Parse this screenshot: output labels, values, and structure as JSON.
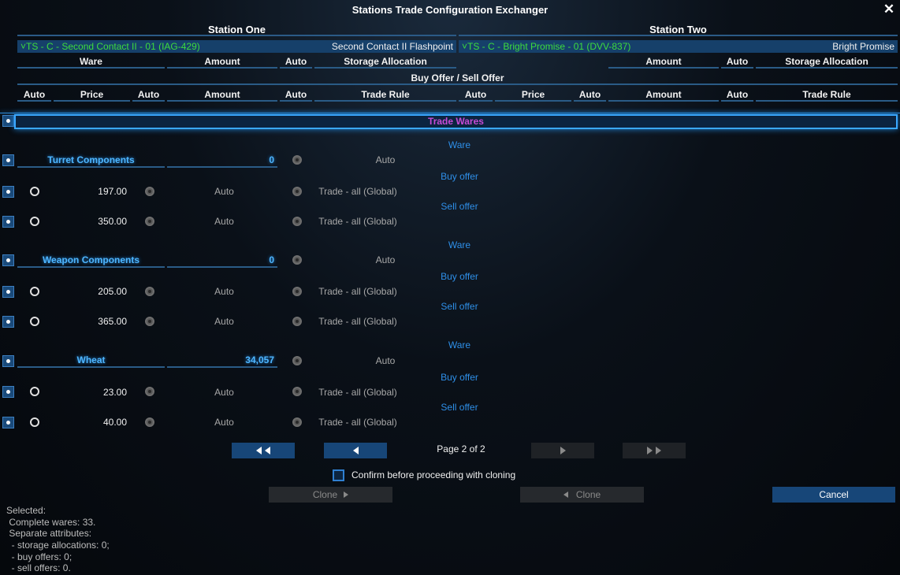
{
  "window": {
    "title": "Stations Trade Configuration Exchanger",
    "close_label": "✕"
  },
  "station_one": {
    "title": "Station One",
    "dropdown_left": "˅TS - C - Second Contact II - 01 (IAG-429)",
    "dropdown_right": "Second Contact II Flashpoint",
    "headers": {
      "ware": "Ware",
      "amount": "Amount",
      "auto": "Auto",
      "storage": "Storage Allocation"
    },
    "offer_headers": {
      "auto1": "Auto",
      "price": "Price",
      "auto2": "Auto",
      "amount": "Amount",
      "auto3": "Auto",
      "trade_rule": "Trade Rule"
    }
  },
  "station_two": {
    "title": "Station Two",
    "dropdown_left": "˅TS - C - Bright Promise - 01 (DVV-837)",
    "dropdown_right": "Bright Promise",
    "headers": {
      "amount": "Amount",
      "auto": "Auto",
      "storage": "Storage Allocation"
    },
    "offer_headers": {
      "auto1": "Auto",
      "price": "Price",
      "auto2": "Auto",
      "amount": "Amount",
      "auto3": "Auto",
      "trade_rule": "Trade Rule"
    }
  },
  "buy_sell_header": "Buy Offer / Sell Offer",
  "trade_wares_label": "Trade Wares",
  "wares": [
    {
      "name": "Turret Components",
      "amount": "0",
      "storage_auto": "Auto",
      "ware_label": "Ware",
      "buy_label": "Buy offer",
      "sell_label": "Sell offer",
      "buy": {
        "price": "197.00",
        "amount": "Auto",
        "rule": "Trade - all (Global)"
      },
      "sell": {
        "price": "350.00",
        "amount": "Auto",
        "rule": "Trade - all (Global)"
      }
    },
    {
      "name": "Weapon Components",
      "amount": "0",
      "storage_auto": "Auto",
      "ware_label": "Ware",
      "buy_label": "Buy offer",
      "sell_label": "Sell offer",
      "buy": {
        "price": "205.00",
        "amount": "Auto",
        "rule": "Trade - all (Global)"
      },
      "sell": {
        "price": "365.00",
        "amount": "Auto",
        "rule": "Trade - all (Global)"
      }
    },
    {
      "name": "Wheat",
      "amount": "34,057",
      "storage_auto": "Auto",
      "ware_label": "Ware",
      "buy_label": "Buy offer",
      "sell_label": "Sell offer",
      "buy": {
        "price": "23.00",
        "amount": "Auto",
        "rule": "Trade - all (Global)"
      },
      "sell": {
        "price": "40.00",
        "amount": "Auto",
        "rule": "Trade - all (Global)"
      }
    }
  ],
  "pagination": {
    "label": "Page 2 of 2"
  },
  "confirm_label": "Confirm before proceeding with cloning",
  "buttons": {
    "clone_right": "Clone",
    "clone_left": "Clone",
    "cancel": "Cancel"
  },
  "selected": {
    "l1": "Selected:",
    "l2": " Complete wares: 33.",
    "l3": " Separate attributes:",
    "l4": "  - storage allocations: 0;",
    "l5": "  - buy offers: 0;",
    "l6": "  - sell offers: 0."
  },
  "colors": {
    "accent": "#174678",
    "ware_blue": "#4fb6ff",
    "trade_wares": "#c74bd6",
    "selected_green": "#3ddb3d"
  }
}
